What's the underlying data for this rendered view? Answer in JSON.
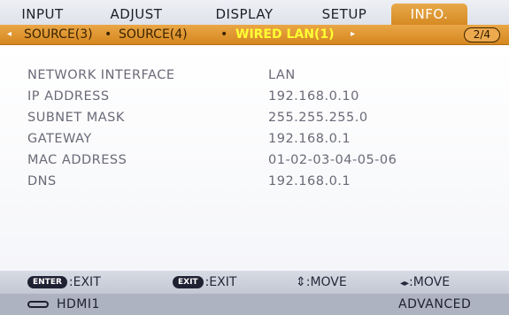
{
  "tabs": [
    "INPUT",
    "ADJUST",
    "DISPLAY",
    "SETUP",
    "INFO."
  ],
  "subtabs": {
    "left_arrow": "◂",
    "items": [
      "SOURCE(3)",
      "SOURCE(4)",
      "WIRED LAN(1)"
    ],
    "separator": "•",
    "right_arrow": "▸",
    "page": "2/4"
  },
  "rows": [
    {
      "label": "NETWORK INTERFACE",
      "value": "LAN"
    },
    {
      "label": "IP ADDRESS",
      "value": "192.168.0.10"
    },
    {
      "label": "SUBNET MASK",
      "value": "255.255.255.0"
    },
    {
      "label": "GATEWAY",
      "value": "192.168.0.1"
    },
    {
      "label": "MAC ADDRESS",
      "value": "01-02-03-04-05-06"
    },
    {
      "label": "DNS",
      "value": "192.168.0.1"
    }
  ],
  "footer": {
    "enter_key": "ENTER",
    "enter_action": ":EXIT",
    "exit_key": "EXIT",
    "exit_action": ":EXIT",
    "move_ud_icon": "⇕",
    "move_ud": ":MOVE",
    "move_lr_icon": "◂▸",
    "move_lr": ":MOVE"
  },
  "status": {
    "input_icon": "hdmi-connector-icon",
    "input": "HDMI1",
    "mode": "ADVANCED"
  },
  "colors": {
    "active_tab": "#d68a23",
    "active_subtab_text": "#ffff33"
  }
}
